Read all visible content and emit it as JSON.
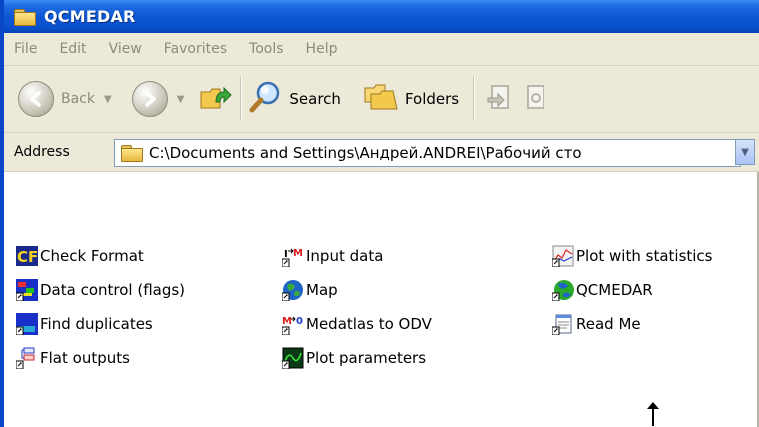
{
  "window": {
    "title": "QCMEDAR"
  },
  "menu": [
    "File",
    "Edit",
    "View",
    "Favorites",
    "Tools",
    "Help"
  ],
  "toolbar": {
    "back_label": "Back",
    "search_label": "Search",
    "folders_label": "Folders"
  },
  "address": {
    "label": "Address",
    "value": "C:\\Documents and Settings\\Андрей.ANDREI\\Рабочий сто"
  },
  "files": [
    {
      "label": "Check Format",
      "icon": "check-format-icon"
    },
    {
      "label": "Data control (flags)",
      "icon": "data-control-icon"
    },
    {
      "label": "Find duplicates",
      "icon": "find-duplicates-icon"
    },
    {
      "label": "Flat outputs",
      "icon": "flat-outputs-icon"
    },
    {
      "label": "Input data",
      "icon": "input-data-icon"
    },
    {
      "label": "Map",
      "icon": "globe-icon"
    },
    {
      "label": "Medatlas to ODV",
      "icon": "medatlas-icon"
    },
    {
      "label": "Plot parameters",
      "icon": "plot-parameters-icon"
    },
    {
      "label": "Plot with statistics",
      "icon": "plot-statistics-icon"
    },
    {
      "label": "QCMEDAR",
      "icon": "qcmedar-globe-icon"
    },
    {
      "label": "Read Me",
      "icon": "notepad-icon"
    }
  ]
}
